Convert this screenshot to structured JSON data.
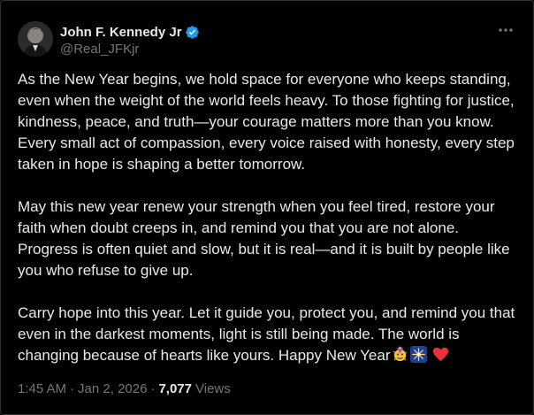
{
  "author": {
    "display_name": "John F. Kennedy Jr",
    "handle": "@Real_JFKjr",
    "verified": true,
    "verified_color": "#1d9bf0"
  },
  "tweet": {
    "paragraphs": [
      "As the New Year begins, we hold space for everyone who keeps standing, even when the weight of the world feels heavy. To those fighting for justice, kindness, peace, and truth—your courage matters more than you know. Every small act of compassion, every voice raised with honesty, every step taken in hope is shaping a better tomorrow.",
      "May this new year renew your strength when you feel tired, restore your faith when doubt creeps in, and remind you that you are not alone. Progress is often quiet and slow, but it is real—and it is built by people like you who refuse to give up.",
      "Carry hope into this year. Let it guide you, protect you, and remind you that even in the darkest moments, light is still being made. The world is changing because of hearts like yours. Happy New Year"
    ],
    "trailing_emojis": [
      "party-face-emoji",
      "fireworks-emoji",
      "red-heart-emoji"
    ]
  },
  "meta": {
    "time": "1:45 AM",
    "separator": "·",
    "date": "Jan 2, 2026",
    "views_count": "7,077",
    "views_label": "Views"
  },
  "colors": {
    "background": "#000000",
    "text": "#e7e9ea",
    "secondary": "#71767b",
    "border": "#2f3336"
  }
}
